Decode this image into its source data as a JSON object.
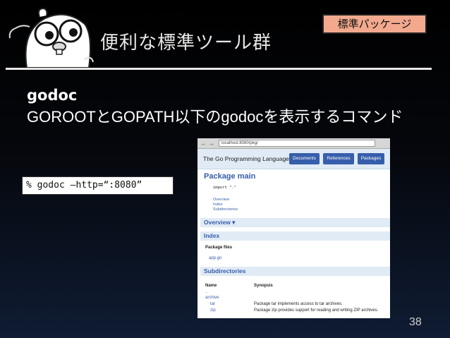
{
  "slide": {
    "title": "便利な標準ツール群",
    "badge": "標準パッケージ",
    "subhead": "godoc",
    "description": "GOROOTとGOPATH以下のgodocを表示するコマンド",
    "command": "% godoc –http=“:8080”",
    "page_number": "38"
  },
  "browser": {
    "back_glyph": "←",
    "forward_glyph": "→",
    "url": "localhost:8080/pkg/",
    "site_name": "The Go Programming Language",
    "tabs": [
      "Documents",
      "References",
      "Packages"
    ],
    "package_title": "Package main",
    "import_line": "import \".\"",
    "toc": [
      "Overview",
      "Index",
      "Subdirectories"
    ],
    "sections": {
      "overview": "Overview ▾",
      "index": "Index",
      "subdirectories": "Subdirectories"
    },
    "package_files_label": "Package files",
    "package_file": "app.go",
    "table_headers": {
      "name": "Name",
      "synopsis": "Synopsis"
    },
    "parent_dir": "..",
    "rows": [
      {
        "name": "archive",
        "synopsis": ""
      },
      {
        "name": "tar",
        "synopsis": "Package tar implements access to tar archives."
      },
      {
        "name": "zip",
        "synopsis": "Package zip provides support for reading and writing ZIP archives."
      }
    ]
  },
  "colors": {
    "accent_blue": "#375eab",
    "badge_fill": "#f2a98e",
    "header_fill": "#e0ebf5"
  }
}
